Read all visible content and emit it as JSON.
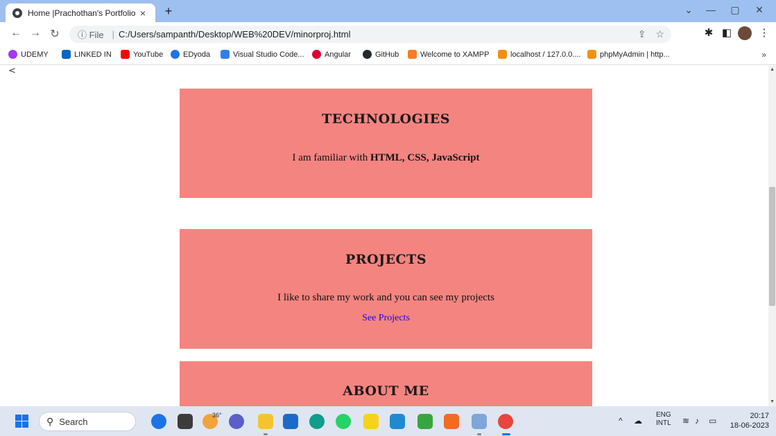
{
  "browser": {
    "tab_title": "Home |Prachothan's Portfolio",
    "tab_close": "×",
    "new_tab": "+",
    "url_info": "ⓘ File",
    "url": "C:/Users/sampanth/Desktop/WEB%20DEV/minorproj.html",
    "bookmarks": [
      {
        "label": "UDEMY",
        "color": "#a435f0"
      },
      {
        "label": "LINKED IN",
        "color": "#0a66c2"
      },
      {
        "label": "YouTube",
        "color": "#ff0000"
      },
      {
        "label": "EDyoda",
        "color": "#1e73e8"
      },
      {
        "label": "Visual Studio Code...",
        "color": "#2f80ed"
      },
      {
        "label": "Angular",
        "color": "#dd0031"
      },
      {
        "label": "GitHub",
        "color": "#24292e"
      },
      {
        "label": "Welcome to XAMPP",
        "color": "#fb7a24"
      },
      {
        "label": "localhost / 127.0.0....",
        "color": "#f29111"
      },
      {
        "label": "phpMyAdmin | http...",
        "color": "#f29111"
      }
    ],
    "bookmarks_more": "»"
  },
  "page": {
    "back_arrow": "<",
    "technologies": {
      "heading": "TECHNOLOGIES",
      "text_prefix": "I am familiar with ",
      "text_bold": "HTML, CSS, JavaScript"
    },
    "projects": {
      "heading": "PROJECTS",
      "text": "I like to share my work and you can see my projects",
      "link": "See Projects"
    },
    "about": {
      "heading": "ABOUT ME"
    }
  },
  "taskbar": {
    "search_label": "Search",
    "weather": "36°",
    "lang_top": "ENG",
    "lang_bottom": "INTL",
    "time": "20:17",
    "date": "18-06-2023"
  }
}
